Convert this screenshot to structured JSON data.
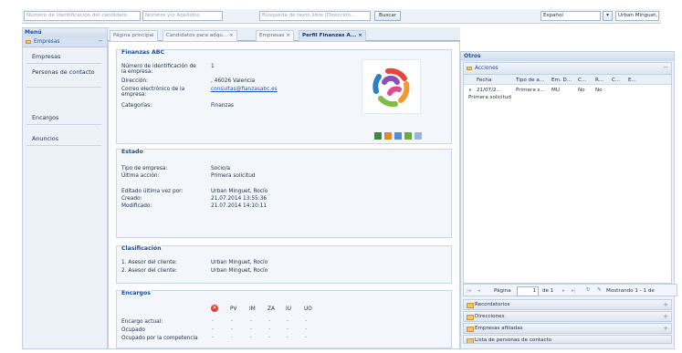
{
  "topbar": {
    "id_placeholder": "Número de identificación del candidato",
    "name_placeholder": "Nombre y/o Apellidos",
    "search_placeholder": "Búsqueda de texto libre (Dirección...",
    "search_button": "Buscar",
    "language": "Español",
    "user": "Urban Minguet, Ro"
  },
  "sidebar": {
    "title": "Menú",
    "section": "Empresas",
    "items": [
      "Empresas",
      "Personas de contacto",
      "Encargos",
      "Anuncios"
    ]
  },
  "tabs": [
    "Página principal",
    "Candidatos para adqu...",
    "Empresas",
    "Perfil Finanzas A..."
  ],
  "company": {
    "name": "Finanzas ABC",
    "fields": [
      {
        "label": "Número de identificación de la empresa:",
        "value": "1"
      },
      {
        "label": "Dirección:",
        "value": ", 46026 Valencia"
      },
      {
        "label": "Correo electrónico de la empresa:",
        "value": "consultas@fianzasabc.es"
      },
      {
        "label": "Categorías:",
        "value": "Finanzas"
      }
    ]
  },
  "estado": {
    "title": "Estado",
    "fields": [
      {
        "label": "Tipo de empresa:",
        "value": "Socio/a"
      },
      {
        "label": "Última acción:",
        "value": "Primera solicitud"
      },
      {
        "label": "Editado última vez por:",
        "value": "Urban Minguet, Rocío"
      },
      {
        "label": "Creado:",
        "value": "21.07.2014 13:55:36"
      },
      {
        "label": "Modificado:",
        "value": "21.07.2014 14:10:11"
      }
    ]
  },
  "clasificacion": {
    "title": "Clasificación",
    "fields": [
      {
        "label": "1. Asesor del cliente:",
        "value": "Urban Minguet, Rocío"
      },
      {
        "label": "2. Asesor del cliente:",
        "value": "Urban Minguet, Rocío"
      }
    ]
  },
  "encargos": {
    "title": "Encargos",
    "columns": [
      "PV",
      "IM",
      "ZA",
      "IU",
      "UO"
    ],
    "rows": [
      {
        "label": "Encargo actual:",
        "values": [
          "-",
          "-",
          "-",
          "-",
          "-",
          "-"
        ]
      },
      {
        "label": "Ocupado",
        "values": [
          "-",
          "-",
          "-",
          "-",
          "-",
          "-"
        ]
      },
      {
        "label": "Ocupado por la competencia",
        "values": [
          "-",
          "-",
          "-",
          "-",
          "-",
          "-"
        ]
      }
    ]
  },
  "right": {
    "title": "Otros",
    "acciones": {
      "title": "Acciones",
      "headers": [
        "Fecha",
        "Tipo de a...",
        "Em. D...",
        "C...",
        "R...",
        "C...",
        "E..."
      ],
      "row": [
        "21/07/2...",
        "Primera s...",
        "MU",
        "No",
        "No"
      ],
      "row_detail": "Primera solicitud"
    },
    "pager": {
      "page_label": "Página",
      "page_value": "1",
      "of_label": "de 1",
      "showing": "Mostrando 1 - 1 de"
    },
    "sections": [
      "Recordatorios",
      "Direcciones",
      "Empresas afiliadas",
      "Lista de personas de contacto"
    ]
  },
  "colors": {
    "accent": "#1d4f91",
    "header_bg": "#dfe8f3",
    "logo": [
      "#e8463c",
      "#f29a2e",
      "#7fbd43",
      "#2c7fc1",
      "#8a4fb5"
    ]
  }
}
